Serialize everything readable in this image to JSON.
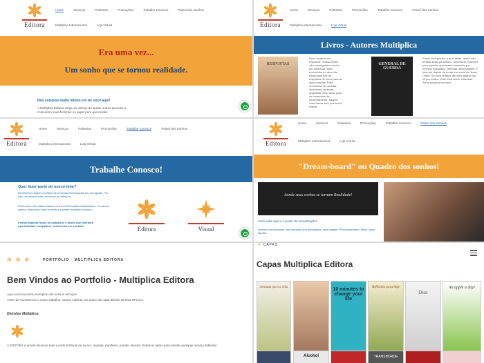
{
  "brand": {
    "logo_text": "Editora",
    "visual_text": "Visual"
  },
  "nav": {
    "items": [
      "Home",
      "Serviços",
      "Palestras",
      "Promoções",
      "Trabalhe Conosco",
      "Painel dos Sonhos"
    ],
    "row2": [
      "Multiplica Internacional",
      "Loja Virtual"
    ]
  },
  "p1": {
    "title1": "Era uma vez...",
    "title2": "Um sonho que se tornou realidade.",
    "sub": "Nós estamos muito felizes em ter você aqui!",
    "body": "A Multiplica Editora surgiu do desejo de ajudar outras pessoas a colocarem suas histórias no papel para que muitas"
  },
  "p2": {
    "banner": "Livros - Autores Multiplica",
    "book1": "RESPOSTAS",
    "book2": "GENERAL DE GUERRA",
    "col1": "Deus sempre nos responde, muitas vezes não conseguimos ouvi-lo, por estarmos muito envolvidos no dia a dia. Respostas traz as respostas de Deus para as suas orações. Para momentos de dúvidas, incertezas, tristezas, angústias, bem como para os momentos de contentamento, alegria. Uma leitura leve que te faz refletir.",
    "col2": "Existe uma guerra, a qual estás, talvez não tenhas ainda percebido. General de Guerra é para aqueles que foram chamados por eventos passados, enfrentar adversidades, e lutar até depois da morte em nome de Jesus Cristo. Se você chegou até esta página não foi por acaso. Você está sendo chamado. Torne posse a teu uma."
  },
  "p3": {
    "banner": "Trabalhe Conosco!",
    "q": "Quer fazer parte do nosso time?",
    "t1": "Recebemos alguns contatos de pessoas interessadas em nos ajudar. Por isso, decidimos criar um banco de talentos!",
    "t2": "Preencha o formulário abaixo com as informações solicitadas e, no campo abaixo, descreva o que te motiva a querer trabalhar conosco.",
    "t3": "Iremos analisar todos os cadastros e assim que tivermos oportunidade compatível, entraremos em contato!"
  },
  "p4": {
    "banner": "\"Dream-board\" ou Quadro dos sonhos!",
    "board_text": "Aonde seus sonhos se tornam Realidade!",
    "q": "Você sabe qual é o poder da Visualização?",
    "body": "Quando visualizamos uma situação que almejamos, uma viagem, Relacionamento, filhos, casa, família..."
  },
  "p5": {
    "crumb": "PORTFOLIO  ·  MULTIPLICA EDITORA",
    "title": "Bem Vindos ao Portfolio - Multiplica Editora",
    "intro1": "Aqui você encontra exemplos dos nossos serviços.",
    "intro2": "Antes de mostrarmos o nosso trabalho, vamos explicar um pouco de cada divisão da MULTIPLICA.",
    "div_label": "Divisões Multiplica:",
    "bottom": "A EDITORA é aonde fazemos toda a parte Editorial de Livros, revistas, panfletos, jornais, ebooks. Estamos aptos para prestar qualquer serviço Editorial."
  },
  "p6": {
    "crumb": "CAPAS",
    "title": "Capas Multiplica Editora",
    "covers": [
      "Jornada para a vida",
      "",
      "10 minutes to change your life",
      "Reflexões para hoje",
      "Dias",
      "An apple a day!"
    ],
    "covers2": [
      "",
      "Alcohol",
      "",
      "TRANSBORDE",
      "",
      ""
    ]
  },
  "colors": {
    "orange": "#f2a33a",
    "blue": "#2469a1",
    "red": "#c0392b",
    "whatsapp": "#25a145"
  }
}
